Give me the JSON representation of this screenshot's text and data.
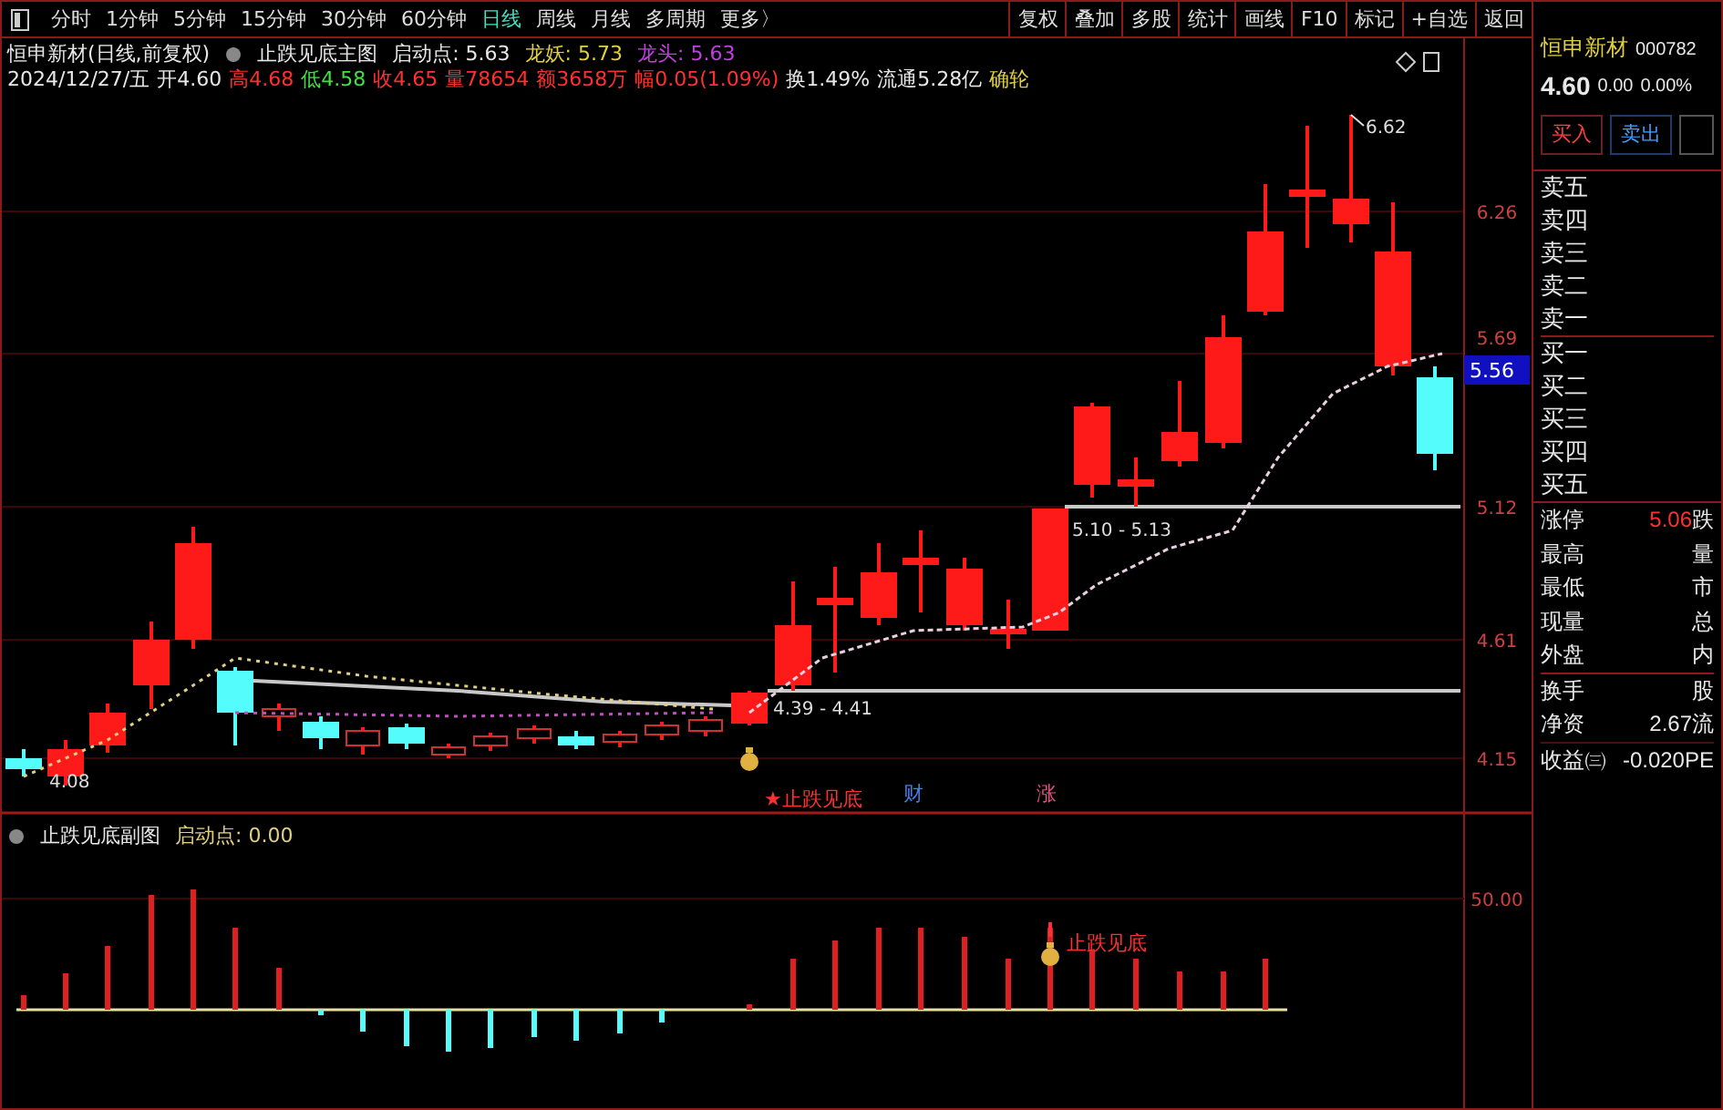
{
  "toolbar": {
    "periods": [
      {
        "label": "分时",
        "selected": false
      },
      {
        "label": "1分钟",
        "selected": false
      },
      {
        "label": "5分钟",
        "selected": false
      },
      {
        "label": "15分钟",
        "selected": false
      },
      {
        "label": "30分钟",
        "selected": false
      },
      {
        "label": "60分钟",
        "selected": false
      },
      {
        "label": "日线",
        "selected": true
      },
      {
        "label": "周线",
        "selected": false
      },
      {
        "label": "月线",
        "selected": false
      },
      {
        "label": "多周期",
        "selected": false
      },
      {
        "label": "更多〉",
        "selected": false
      }
    ],
    "tools": [
      "复权",
      "叠加",
      "多股",
      "统计",
      "画线",
      "F10",
      "标记",
      "+自选",
      "返回"
    ]
  },
  "main_chart": {
    "title": "恒申新材(日线,前复权)",
    "indicator": "止跌见底主图",
    "params": [
      {
        "text": "启动点: 5.63",
        "color": "#e8e8e8"
      },
      {
        "text": "龙妖: 5.73",
        "color": "#e0d040"
      },
      {
        "text": "龙头: 5.63",
        "color": "#c040e0"
      }
    ],
    "info_line": [
      {
        "text": "2024/12/27/五",
        "color": "#e8e8e8"
      },
      {
        "text": "开4.60",
        "color": "#e8e8e8"
      },
      {
        "text": "高4.68",
        "color": "#ff3030"
      },
      {
        "text": "低4.58",
        "color": "#40e040"
      },
      {
        "text": "收4.65",
        "color": "#ff3030"
      },
      {
        "text": "量78654",
        "color": "#ff3030"
      },
      {
        "text": "额3658万",
        "color": "#ff3030"
      },
      {
        "text": "幅0.05(1.09%)",
        "color": "#ff3030"
      },
      {
        "text": "换1.49%",
        "color": "#e8e8e8"
      },
      {
        "text": "流通5.28亿",
        "color": "#e8e8e8"
      },
      {
        "text": "确轮",
        "color": "#e0d040"
      }
    ],
    "price_axis": [
      "6.26",
      "5.69",
      "5.12",
      "4.61",
      "4.15"
    ],
    "current_price_tag": "5.56",
    "peak_label": "6.62",
    "low_label": "4.08",
    "range_labels": [
      "5.10 - 5.13",
      "4.39 - 4.41"
    ],
    "signal": "★止跌见底",
    "event_markers": [
      {
        "text": "财",
        "color": "#4080e0"
      },
      {
        "text": "涨",
        "color": "#e05080"
      }
    ]
  },
  "sub_chart": {
    "indicator": "止跌见底副图",
    "param": "启动点: 0.00",
    "axis_label": "50.00",
    "signal": "止跌见底"
  },
  "quote_panel": {
    "name": "恒申新材",
    "code": "000782",
    "price": "4.60",
    "change": "0.00",
    "change_pct": "0.00%",
    "buttons": [
      "买入",
      "卖出"
    ],
    "order_book": [
      "卖五",
      "卖四",
      "卖三",
      "卖二",
      "卖一",
      "买一",
      "买二",
      "买三",
      "买四",
      "买五"
    ],
    "stats": [
      {
        "label": "涨停",
        "value": "5.06",
        "label_2": "跌"
      },
      {
        "label": "最高",
        "label_2": "量"
      },
      {
        "label": "最低",
        "label_2": "市"
      },
      {
        "label": "现量",
        "label_2": "总"
      },
      {
        "label": "外盘",
        "label_2": "内"
      },
      {
        "label": "换手",
        "label_2": "股"
      },
      {
        "label": "净资",
        "value": "2.67",
        "label_2": "流"
      },
      {
        "label": "收益㈢",
        "value": "-0.020",
        "label_2": "PE"
      }
    ]
  }
}
